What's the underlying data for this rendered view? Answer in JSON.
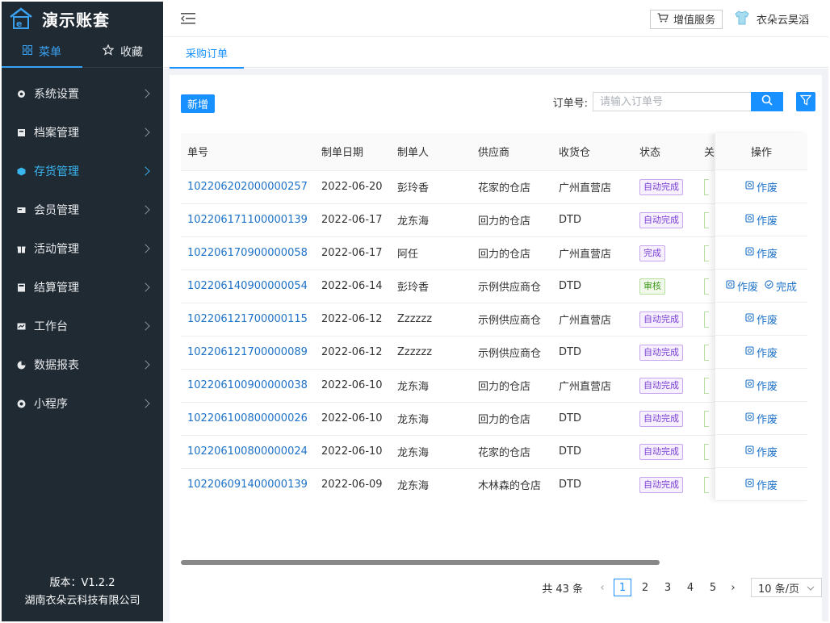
{
  "brand": {
    "name": "演示账套",
    "logo_icon": "shop-logo-icon"
  },
  "sidebar": {
    "tabs": [
      {
        "label": "菜单",
        "icon": "grid-icon",
        "active": true
      },
      {
        "label": "收藏",
        "icon": "star-icon",
        "active": false
      }
    ],
    "items": [
      {
        "label": "系统设置",
        "icon": "settings-icon"
      },
      {
        "label": "档案管理",
        "icon": "archive-icon"
      },
      {
        "label": "存货管理",
        "icon": "inventory-icon",
        "active": true
      },
      {
        "label": "会员管理",
        "icon": "member-icon"
      },
      {
        "label": "活动管理",
        "icon": "gift-icon"
      },
      {
        "label": "结算管理",
        "icon": "calculator-icon"
      },
      {
        "label": "工作台",
        "icon": "workbench-icon"
      },
      {
        "label": "数据报表",
        "icon": "report-icon"
      },
      {
        "label": "小程序",
        "icon": "miniapp-icon"
      }
    ],
    "footer": {
      "version": "版本：V1.2.2",
      "company": "湖南衣朵云科技有限公司"
    }
  },
  "topbar": {
    "value_added": "增值服务",
    "username": "衣朵云昊滔"
  },
  "tabs": {
    "current": "采购订单"
  },
  "toolbar": {
    "new_label": "新增",
    "search_label": "订单号:",
    "search_placeholder": "请输入订单号"
  },
  "table": {
    "columns": [
      "单号",
      "制单日期",
      "制单人",
      "供应商",
      "收货仓",
      "状态",
      "关",
      "操作"
    ],
    "rows": [
      {
        "order": "102206202000000257",
        "date": "2022-06-20",
        "creator": "彭玲香",
        "supplier": "花家的仓店",
        "warehouse": "广州直营店",
        "status": "自动完成",
        "status_type": "auto",
        "actions": [
          "作废"
        ]
      },
      {
        "order": "102206171100000139",
        "date": "2022-06-17",
        "creator": "龙东海",
        "supplier": "回力的仓店",
        "warehouse": "DTD",
        "status": "自动完成",
        "status_type": "auto",
        "actions": [
          "作废"
        ]
      },
      {
        "order": "102206170900000058",
        "date": "2022-06-17",
        "creator": "阿任",
        "supplier": "回力的仓店",
        "warehouse": "广州直营店",
        "status": "完成",
        "status_type": "done",
        "actions": [
          "作废"
        ]
      },
      {
        "order": "102206140900000054",
        "date": "2022-06-14",
        "creator": "彭玲香",
        "supplier": "示例供应商仓",
        "warehouse": "DTD",
        "status": "审核",
        "status_type": "review",
        "actions": [
          "作废",
          "完成"
        ]
      },
      {
        "order": "102206121700000115",
        "date": "2022-06-12",
        "creator": "Zzzzzz",
        "supplier": "示例供应商仓",
        "warehouse": "广州直营店",
        "status": "自动完成",
        "status_type": "auto",
        "actions": [
          "作废"
        ]
      },
      {
        "order": "102206121700000089",
        "date": "2022-06-12",
        "creator": "Zzzzzz",
        "supplier": "示例供应商仓",
        "warehouse": "DTD",
        "status": "自动完成",
        "status_type": "auto",
        "actions": [
          "作废"
        ]
      },
      {
        "order": "102206100900000038",
        "date": "2022-06-10",
        "creator": "龙东海",
        "supplier": "回力的仓店",
        "warehouse": "广州直营店",
        "status": "自动完成",
        "status_type": "auto",
        "actions": [
          "作废"
        ]
      },
      {
        "order": "102206100800000026",
        "date": "2022-06-10",
        "creator": "龙东海",
        "supplier": "回力的仓店",
        "warehouse": "DTD",
        "status": "自动完成",
        "status_type": "auto",
        "actions": [
          "作废"
        ]
      },
      {
        "order": "102206100800000024",
        "date": "2022-06-10",
        "creator": "龙东海",
        "supplier": "花家的仓店",
        "warehouse": "DTD",
        "status": "自动完成",
        "status_type": "auto",
        "actions": [
          "作废"
        ]
      },
      {
        "order": "102206091400000139",
        "date": "2022-06-09",
        "creator": "龙东海",
        "supplier": "木林森的仓店",
        "warehouse": "DTD",
        "status": "自动完成",
        "status_type": "auto",
        "actions": [
          "作废"
        ]
      }
    ]
  },
  "pagination": {
    "total": "共 43 条",
    "pages": [
      "1",
      "2",
      "3",
      "4",
      "5"
    ],
    "current": "1",
    "page_size": "10 条/页"
  },
  "colors": {
    "primary": "#1890ff",
    "sidebar_bg": "#1f2a33",
    "active_menu": "#39b5f0"
  }
}
